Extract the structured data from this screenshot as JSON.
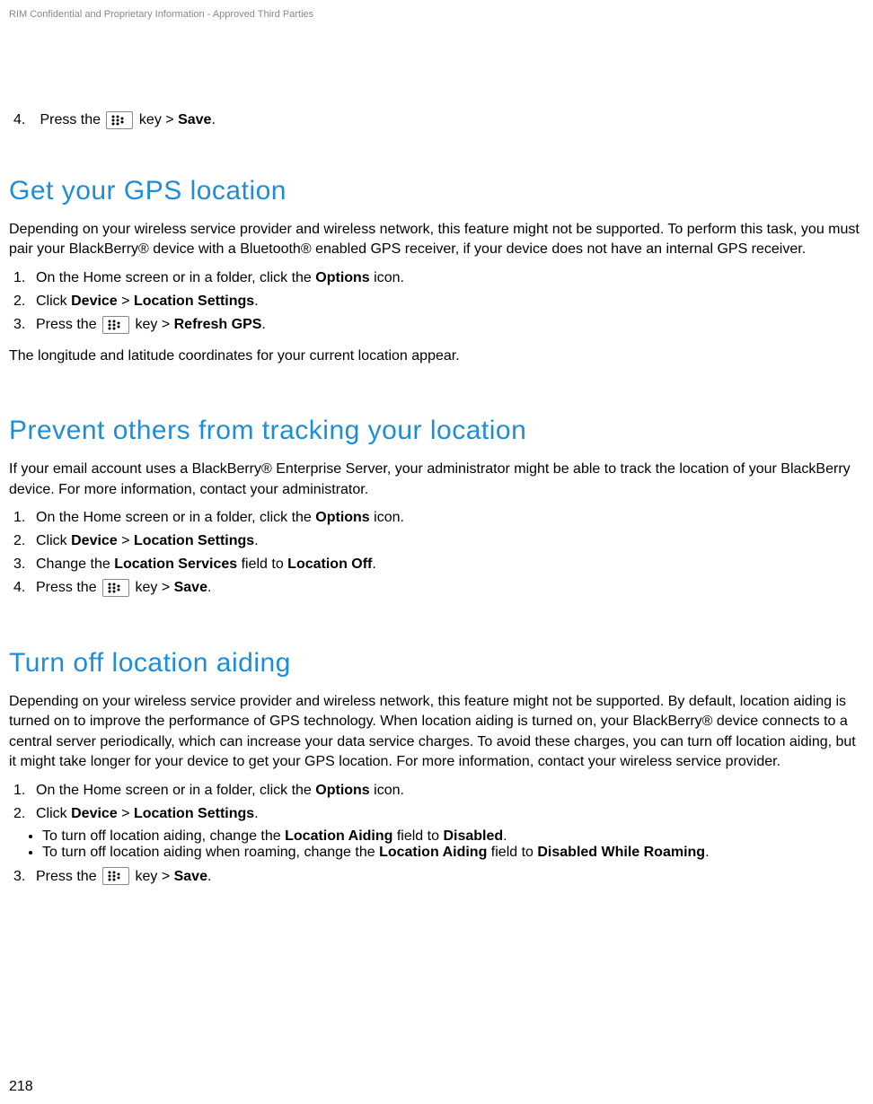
{
  "header": {
    "confidential": "RIM Confidential and Proprietary Information - Approved Third Parties"
  },
  "intro_step": {
    "num": "4.",
    "pre": "Press the ",
    "post_key": " key > ",
    "bold": "Save",
    "end": "."
  },
  "sections": {
    "gps": {
      "heading": "Get your GPS location",
      "intro": "Depending on your wireless service provider and wireless network, this feature might not be supported. To perform this task, you must pair your BlackBerry® device with a Bluetooth® enabled GPS receiver, if your device does not have an internal GPS receiver.",
      "steps": {
        "s1": {
          "num": "1.",
          "pre": "On the Home screen or in a folder, click the ",
          "b1": "Options",
          "post": " icon."
        },
        "s2": {
          "num": "2.",
          "pre": "Click ",
          "b1": "Device",
          "mid": " > ",
          "b2": "Location Settings",
          "post": "."
        },
        "s3": {
          "num": "3.",
          "pre": "Press the ",
          "post_key": " key > ",
          "b1": "Refresh GPS",
          "end": "."
        }
      },
      "outro": "The longitude and latitude coordinates for your current location appear."
    },
    "prevent": {
      "heading": "Prevent others from tracking your location",
      "intro": "If your email account uses a BlackBerry® Enterprise Server, your administrator might be able to track the location of your BlackBerry device. For more information, contact your administrator.",
      "steps": {
        "s1": {
          "num": "1.",
          "pre": "On the Home screen or in a folder, click the ",
          "b1": "Options",
          "post": " icon."
        },
        "s2": {
          "num": "2.",
          "pre": "Click ",
          "b1": "Device",
          "mid": " > ",
          "b2": "Location Settings",
          "post": "."
        },
        "s3": {
          "num": "3.",
          "pre": "Change the ",
          "b1": "Location Services",
          "mid": " field to ",
          "b2": "Location Off",
          "post": "."
        },
        "s4": {
          "num": "4.",
          "pre": "Press the ",
          "post_key": " key > ",
          "b1": "Save",
          "end": "."
        }
      }
    },
    "aiding": {
      "heading": "Turn off location aiding",
      "intro": "Depending on your wireless service provider and wireless network, this feature might not be supported. By default, location aiding is turned on to improve the performance of GPS technology. When location aiding is turned on, your BlackBerry® device connects to a central server periodically, which can increase your data service charges. To avoid these charges, you can turn off location aiding, but it might take longer for your device to get your GPS location. For more information, contact your wireless service provider.",
      "steps": {
        "s1": {
          "num": "1.",
          "pre": "On the Home screen or in a folder, click the ",
          "b1": "Options",
          "post": " icon."
        },
        "s2": {
          "num": "2.",
          "pre": "Click ",
          "b1": "Device",
          "mid": " > ",
          "b2": "Location Settings",
          "post": "."
        },
        "bullet1": {
          "pre": "To turn off location aiding, change the ",
          "b1": "Location Aiding",
          "mid": " field to ",
          "b2": "Disabled",
          "post": "."
        },
        "bullet2": {
          "pre": "To turn off location aiding when roaming, change the ",
          "b1": "Location Aiding",
          "mid": " field to ",
          "b2": "Disabled While Roaming",
          "post": "."
        },
        "s3": {
          "num": "3.",
          "pre": "Press the ",
          "post_key": " key > ",
          "b1": "Save",
          "end": "."
        }
      }
    }
  },
  "page_number": "218"
}
